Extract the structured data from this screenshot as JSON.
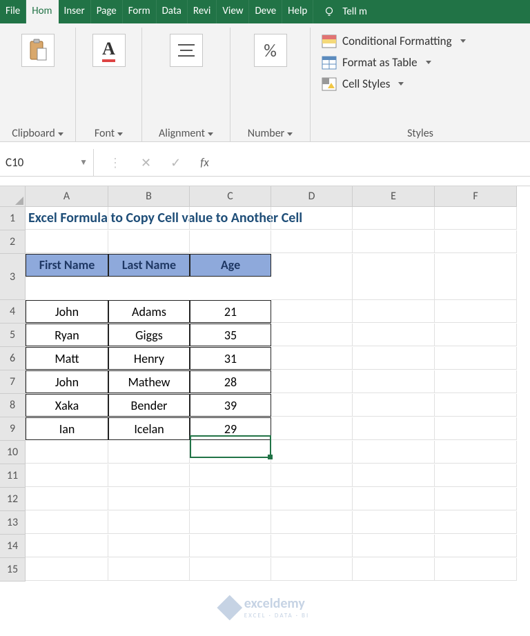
{
  "tabs": {
    "file": "File",
    "home": "Hom",
    "insert": "Inser",
    "page": "Page",
    "formulas": "Form",
    "data": "Data",
    "review": "Revi",
    "view": "View",
    "developer": "Deve",
    "help": "Help",
    "tellme": "Tell m"
  },
  "ribbon": {
    "clipboard": "Clipboard",
    "font": "Font",
    "alignment": "Alignment",
    "number": "Number",
    "styles": "Styles",
    "conditional": "Conditional Formatting",
    "formatTable": "Format as Table",
    "cellStyles": "Cell Styles"
  },
  "formula_bar": {
    "name_box": "C10",
    "fx": "fx",
    "value": ""
  },
  "columns": [
    "A",
    "B",
    "C",
    "D",
    "E",
    "F"
  ],
  "rows": [
    "1",
    "2",
    "3",
    "4",
    "5",
    "6",
    "7",
    "8",
    "9",
    "10",
    "11",
    "12",
    "13",
    "14",
    "15"
  ],
  "sheet": {
    "title": "Excel Formula to Copy Cell value to Another Cell",
    "headers": {
      "first": "First Name",
      "last": "Last Name",
      "age": "Age"
    },
    "data": [
      {
        "first": "John",
        "last": "Adams",
        "age": "21"
      },
      {
        "first": "Ryan",
        "last": "Giggs",
        "age": "35"
      },
      {
        "first": "Matt",
        "last": "Henry",
        "age": "31"
      },
      {
        "first": "John",
        "last": "Mathew",
        "age": "28"
      },
      {
        "first": "Xaka",
        "last": "Bender",
        "age": "39"
      },
      {
        "first": "Ian",
        "last": "Icelan",
        "age": "29"
      }
    ]
  },
  "watermark": {
    "brand": "exceldemy",
    "sub": "EXCEL · DATA · BI"
  },
  "colors": {
    "brand": "#217346",
    "header_fill": "#8ea9db",
    "title_color": "#1f4e78"
  }
}
